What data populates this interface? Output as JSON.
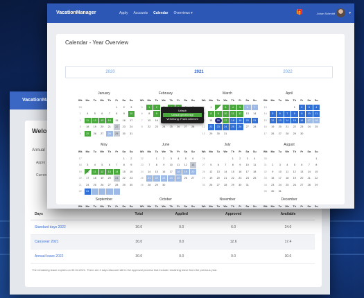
{
  "back_window": {
    "brand": "VacationManager",
    "welcome_title": "Welco",
    "section_title": "Annual",
    "line1": "Appro",
    "line2": "Curren",
    "table": {
      "headers": [
        "Days",
        "Total",
        "Applied",
        "Approved",
        "Available"
      ],
      "rows": [
        [
          "Standard days 2022",
          "30.0",
          "0.0",
          "6.0",
          "24.0"
        ],
        [
          "Carryover 2021",
          "30.0",
          "0.0",
          "12.6",
          "17.4"
        ],
        [
          "Annual leave 2022",
          "30.0",
          "0.0",
          "0.0",
          "30.0"
        ]
      ]
    },
    "footnote": "The remaining leave expires on 30.04.2021. There are 2 days discount still in the approval process that include remaining leave from the previous year."
  },
  "front_window": {
    "brand": "VacationManager",
    "nav": [
      "Apply",
      "Accounts",
      "Calendar",
      "Overviews ▾"
    ],
    "active_nav": "Calendar",
    "gift_icon": "gift-icon",
    "user_name": "Johan Schmidt",
    "page_title": "Calendar - Year Overview",
    "years": [
      "2020",
      "2021",
      "2022"
    ],
    "current_year": "2021",
    "weekday_header": [
      "Wk",
      "Mo",
      "Tu",
      "We",
      "Th",
      "Fr",
      "Sa",
      "Su"
    ],
    "tooltip": {
      "title": "Urlaub",
      "highlight": "Urlaub genehmigt",
      "line": "Verteilung: Frank Albrecht"
    },
    "months": [
      {
        "name": "January",
        "rows": [
          [
            "53",
            "",
            "",
            "",
            "",
            "1",
            "2",
            "3"
          ],
          [
            "1",
            "4",
            "5",
            "6",
            "7",
            "8",
            "9",
            "10"
          ],
          [
            "2",
            "11",
            "12",
            "13",
            "14",
            "15",
            "16",
            "17"
          ],
          [
            "3",
            "18",
            "19",
            "20",
            "21",
            "22",
            "23",
            "24"
          ],
          [
            "4",
            "25",
            "26",
            "27",
            "28",
            "29",
            "30",
            "31"
          ]
        ]
      },
      {
        "name": "February",
        "rows": [
          [
            "5",
            "1",
            "2",
            "3",
            "4",
            "5",
            "6",
            "7"
          ],
          [
            "6",
            "8",
            "9",
            "10",
            "11",
            "12",
            "13",
            "14"
          ],
          [
            "7",
            "15",
            "16",
            "17",
            "18",
            "19",
            "20",
            "21"
          ],
          [
            "8",
            "22",
            "23",
            "24",
            "25",
            "26",
            "27",
            "28"
          ]
        ]
      },
      {
        "name": "March",
        "rows": [
          [
            "9",
            "1",
            "2",
            "3",
            "4",
            "5",
            "6",
            "7"
          ],
          [
            "10",
            "8",
            "9",
            "10",
            "11",
            "12",
            "13",
            "14"
          ],
          [
            "11",
            "15",
            "16",
            "17",
            "18",
            "19",
            "20",
            "21"
          ],
          [
            "12",
            "22",
            "23",
            "24",
            "25",
            "26",
            "27",
            "28"
          ],
          [
            "13",
            "29",
            "30",
            "31",
            "",
            "",
            "",
            ""
          ]
        ]
      },
      {
        "name": "April",
        "rows": [
          [
            "13",
            "",
            "",
            "",
            "1",
            "2",
            "3",
            "4"
          ],
          [
            "14",
            "5",
            "6",
            "7",
            "8",
            "9",
            "10",
            "11"
          ],
          [
            "15",
            "12",
            "13",
            "14",
            "15",
            "16",
            "17",
            "18"
          ],
          [
            "16",
            "19",
            "20",
            "21",
            "22",
            "23",
            "24",
            "25"
          ],
          [
            "17",
            "26",
            "27",
            "28",
            "29",
            "30",
            "",
            ""
          ]
        ]
      },
      {
        "name": "May",
        "rows": [
          [
            "17",
            "",
            "",
            "",
            "",
            "",
            "1",
            "2"
          ],
          [
            "18",
            "3",
            "4",
            "5",
            "6",
            "7",
            "8",
            "9"
          ],
          [
            "19",
            "10",
            "11",
            "12",
            "13",
            "14",
            "15",
            "16"
          ],
          [
            "20",
            "17",
            "18",
            "19",
            "20",
            "21",
            "22",
            "23"
          ],
          [
            "21",
            "24",
            "25",
            "26",
            "27",
            "28",
            "29",
            "30"
          ],
          [
            "22",
            "31",
            "",
            "",
            "",
            "",
            "",
            ""
          ]
        ]
      },
      {
        "name": "June",
        "rows": [
          [
            "22",
            "",
            "1",
            "2",
            "3",
            "4",
            "5",
            "6"
          ],
          [
            "23",
            "7",
            "8",
            "9",
            "10",
            "11",
            "12",
            "13"
          ],
          [
            "24",
            "14",
            "15",
            "16",
            "17",
            "18",
            "19",
            "20"
          ],
          [
            "25",
            "21",
            "22",
            "23",
            "24",
            "25",
            "26",
            "27"
          ],
          [
            "26",
            "28",
            "29",
            "30",
            "",
            "",
            "",
            ""
          ]
        ]
      },
      {
        "name": "July",
        "rows": [
          [
            "26",
            "",
            "",
            "",
            "1",
            "2",
            "3",
            "4"
          ],
          [
            "27",
            "5",
            "6",
            "7",
            "8",
            "9",
            "10",
            "11"
          ],
          [
            "28",
            "12",
            "13",
            "14",
            "15",
            "16",
            "17",
            "18"
          ],
          [
            "29",
            "19",
            "20",
            "21",
            "22",
            "23",
            "24",
            "25"
          ],
          [
            "30",
            "26",
            "27",
            "28",
            "29",
            "30",
            "31",
            ""
          ]
        ]
      },
      {
        "name": "August",
        "rows": [
          [
            "30",
            "",
            "",
            "",
            "",
            "",
            "",
            "1"
          ],
          [
            "31",
            "2",
            "3",
            "4",
            "5",
            "6",
            "7",
            "8"
          ],
          [
            "32",
            "9",
            "10",
            "11",
            "12",
            "13",
            "14",
            "15"
          ],
          [
            "33",
            "16",
            "17",
            "18",
            "19",
            "20",
            "21",
            "22"
          ],
          [
            "34",
            "23",
            "24",
            "25",
            "26",
            "27",
            "28",
            "29"
          ],
          [
            "35",
            "30",
            "31",
            "",
            "",
            "",
            "",
            ""
          ]
        ]
      },
      {
        "name": "September",
        "rows": []
      },
      {
        "name": "October",
        "rows": []
      },
      {
        "name": "November",
        "rows": []
      },
      {
        "name": "December",
        "rows": []
      }
    ],
    "marks": {
      "January": {
        "g": [
          "1-7",
          "2-1",
          "2-2",
          "2-3",
          "2-4",
          "4-1"
        ],
        "gr": [
          "3-5",
          "4-5"
        ],
        "lb": [
          "4-4"
        ]
      },
      "February": {
        "g": [
          "0-1",
          "0-2",
          "0-4",
          "0-5",
          "1-2",
          "1-3"
        ],
        "b": [
          "2-5"
        ]
      },
      "March": {
        "g": [
          "0-3",
          "0-4",
          "0-5",
          "1-1",
          "1-2",
          "1-3",
          "1-4",
          "1-5",
          "2-3"
        ],
        "dg": [
          "0-2"
        ],
        "lb": [
          "0-6",
          "0-7"
        ],
        "b": [
          "2-4",
          "2-5",
          "2-6",
          "2-7",
          "3-1",
          "3-2",
          "3-3",
          "3-4",
          "3-5"
        ],
        "dk": [
          "2-2"
        ]
      },
      "April": {
        "b": [
          "0-5",
          "0-6",
          "0-7",
          "1-1",
          "1-2",
          "1-3",
          "1-4",
          "1-5",
          "1-6",
          "1-7",
          "2-1",
          "2-2",
          "2-3",
          "2-4",
          "2-5"
        ],
        "lb": [
          "2-6",
          "2-7"
        ]
      },
      "May": {
        "dg": [
          "2-1"
        ],
        "g": [
          "2-2",
          "2-3",
          "2-4",
          "2-5"
        ],
        "gr": [
          "3-5"
        ],
        "b": [
          "5-1"
        ],
        "lb": [
          "5-2",
          "5-3",
          "5-4",
          "5-5"
        ]
      },
      "June": {
        "gr": [
          "1-7"
        ],
        "lb": [
          "2-5",
          "2-6",
          "2-7",
          "3-1",
          "3-2",
          "3-3",
          "3-4",
          "3-5"
        ]
      },
      "July": {},
      "August": {}
    }
  }
}
